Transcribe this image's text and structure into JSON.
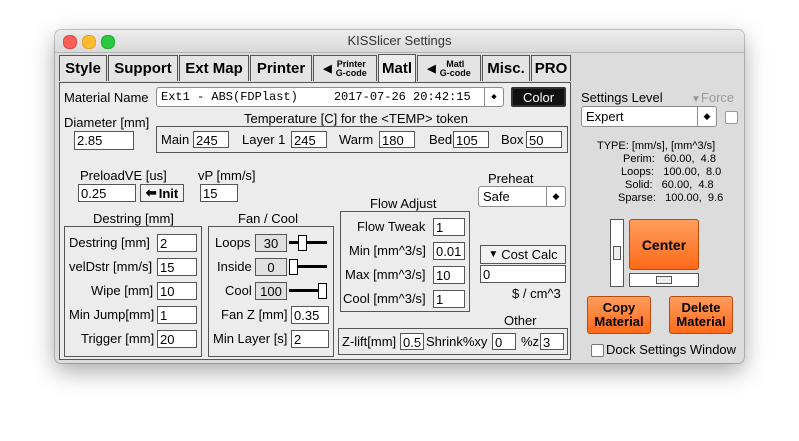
{
  "window": {
    "title": "KISSlicer Settings"
  },
  "tabs": [
    {
      "label": "Style"
    },
    {
      "label": "Support"
    },
    {
      "label": "Ext Map"
    },
    {
      "label": "Printer"
    },
    {
      "label": "Printer G-code",
      "line1": "Printer",
      "line2": "G-code"
    },
    {
      "label": "Matl"
    },
    {
      "label": "Matl G-code",
      "line1": "Matl",
      "line2": "G-code"
    },
    {
      "label": "Misc."
    },
    {
      "label": "PRO"
    }
  ],
  "material": {
    "name_label": "Material Name",
    "name_value": "Ext1 - ABS(FDPlast)     2017-07-26 20:42:15",
    "color_button": "Color"
  },
  "diameter": {
    "label": "Diameter [mm]",
    "value": "2.85"
  },
  "temperature": {
    "title": "Temperature [C] for the <TEMP> token",
    "main_label": "Main",
    "main_value": "245",
    "layer1_label": "Layer 1",
    "layer1_value": "245",
    "warm_label": "Warm",
    "warm_value": "180",
    "bed_label": "Bed",
    "bed_value": "105",
    "box_label": "Box",
    "box_value": "50"
  },
  "preload": {
    "label": "PreloadVE [us]",
    "value": "0.25",
    "init_button": "Init"
  },
  "vp": {
    "label": "vP [mm/s]",
    "value": "15"
  },
  "preheat": {
    "label": "Preheat",
    "value": "Safe"
  },
  "destring": {
    "title": "Destring [mm]",
    "destring_label": "Destring [mm]",
    "destring_value": "2",
    "veldstr_label": "velDstr [mm/s]",
    "veldstr_value": "15",
    "wipe_label": "Wipe [mm]",
    "wipe_value": "10",
    "minjump_label": "Min Jump[mm]",
    "minjump_value": "1",
    "trigger_label": "Trigger [mm]",
    "trigger_value": "20"
  },
  "fan": {
    "title": "Fan / Cool",
    "loops_label": "Loops",
    "loops_value": "30",
    "loops_level": 0.3,
    "inside_label": "Inside",
    "inside_value": "0",
    "inside_level": 0.0,
    "cool_label": "Cool",
    "cool_value": "100",
    "cool_level": 1.0,
    "fanz_label": "Fan Z [mm]",
    "fanz_value": "0.35",
    "minlayer_label": "Min Layer [s]",
    "minlayer_value": "2"
  },
  "flow": {
    "title": "Flow Adjust",
    "tweak_label": "Flow Tweak",
    "tweak_value": "1",
    "min_label": "Min [mm^3/s]",
    "min_value": "0.01",
    "max_label": "Max [mm^3/s]",
    "max_value": "10",
    "cool_label": "Cool [mm^3/s]",
    "cool_value": "1"
  },
  "cost": {
    "button": "Cost Calc",
    "value": "0",
    "unit": "$ / cm^3"
  },
  "other": {
    "title": "Other",
    "zlift_label": "Z-lift[mm]",
    "zlift_value": "0.5",
    "shrinkxy_label": "Shrink%xy",
    "shrinkxy_value": "0",
    "z_label": "%z",
    "z_value": "3"
  },
  "right": {
    "settings_level_label": "Settings Level",
    "force_label": "Force",
    "level_value": "Expert",
    "type_title": "TYPE: [mm/s], [mm^3/s]",
    "perim": "Perim:   60.00,  4.8",
    "loops": "Loops:   100.00,  8.0",
    "solid": "Solid:   60.00,  4.8",
    "sparse": "Sparse:   100.00,  9.6",
    "center_button": "Center",
    "copy_line1": "Copy",
    "copy_line2": "Material",
    "delete_line1": "Delete",
    "delete_line2": "Material",
    "dock_label": "Dock Settings Window"
  },
  "colors": {
    "accent_orange": "#ff7a2a",
    "dark_button": "#111111"
  }
}
